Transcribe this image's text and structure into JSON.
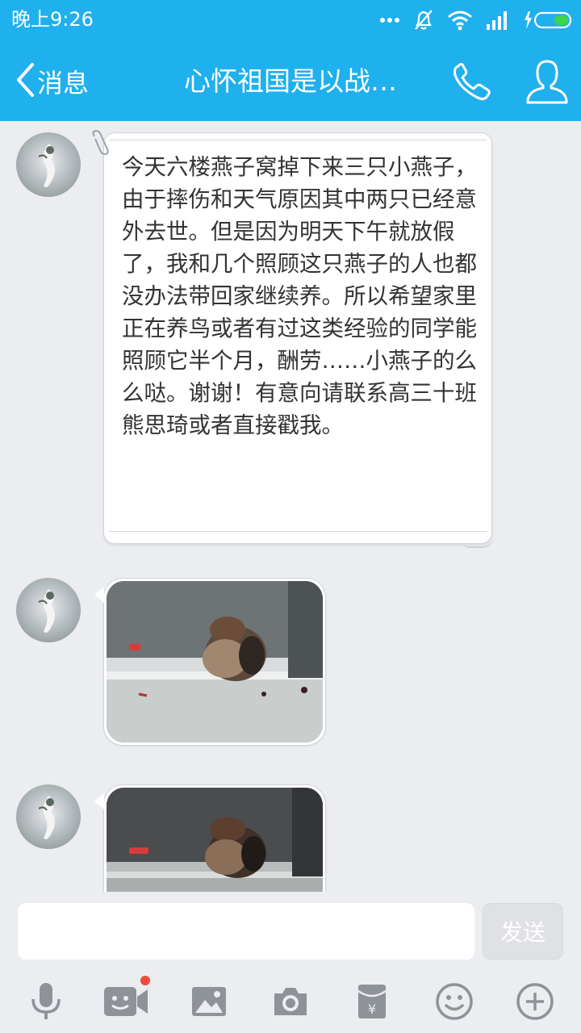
{
  "status_bar": {
    "time": "晚上9:26",
    "icons": [
      "more-dots-icon",
      "mute-bell-icon",
      "wifi-icon",
      "signal-icon",
      "battery-charging-icon"
    ]
  },
  "header": {
    "back_label": "消息",
    "title": "心怀祖国是以战…",
    "accent_color": "#1fb0ee"
  },
  "messages": [
    {
      "type": "text",
      "text": "今天六楼燕子窝掉下来三只小燕子，由于摔伤和天气原因其中两只已经意外去世。但是因为明天下午就放假了，我和几个照顾这只燕子的人也都没办法带回家继续养。所以希望家里正在养鸟或者有过这类经验的同学能照顾它半个月，酬劳……小燕子的么么哒。谢谢！有意向请联系高三十班熊思琦或者直接戳我。"
    },
    {
      "type": "image",
      "subject": "baby swallow on shelf"
    },
    {
      "type": "image",
      "subject": "baby swallow on shelf"
    }
  ],
  "composer": {
    "input_value": "",
    "send_label": "发送"
  },
  "toolbar": {
    "items": [
      "microphone-icon",
      "video-call-icon",
      "picture-icon",
      "camera-icon",
      "red-packet-icon",
      "emoji-icon",
      "plus-icon"
    ],
    "badge_color": "#f04a3b"
  }
}
